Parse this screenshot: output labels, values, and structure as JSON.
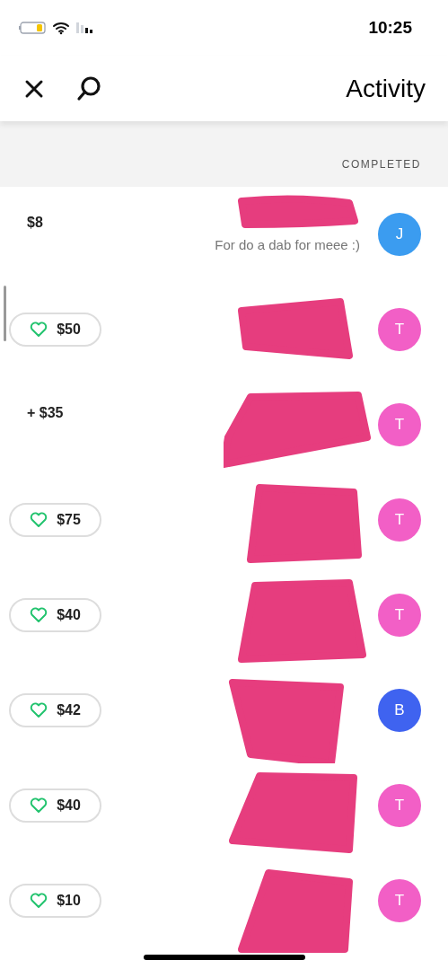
{
  "status_bar": {
    "time": "10:25"
  },
  "header": {
    "title": "Activity"
  },
  "section": {
    "label": "COMPLETED"
  },
  "rows": [
    {
      "initial": "J",
      "color": "#3b9cf0",
      "kind": "plain",
      "amount": "$8",
      "note": "For do a dab for meee :)"
    },
    {
      "initial": "T",
      "color": "#f25fc6",
      "kind": "pill",
      "amount": "$50"
    },
    {
      "initial": "T",
      "color": "#f25fc6",
      "kind": "plain",
      "amount": "+ $35"
    },
    {
      "initial": "T",
      "color": "#f25fc6",
      "kind": "pill",
      "amount": "$75"
    },
    {
      "initial": "T",
      "color": "#f25fc6",
      "kind": "pill",
      "amount": "$40"
    },
    {
      "initial": "B",
      "color": "#3f63f0",
      "kind": "pill",
      "amount": "$42"
    },
    {
      "initial": "T",
      "color": "#f25fc6",
      "kind": "pill",
      "amount": "$40"
    },
    {
      "initial": "T",
      "color": "#f25fc6",
      "kind": "pill",
      "amount": "$10"
    }
  ]
}
